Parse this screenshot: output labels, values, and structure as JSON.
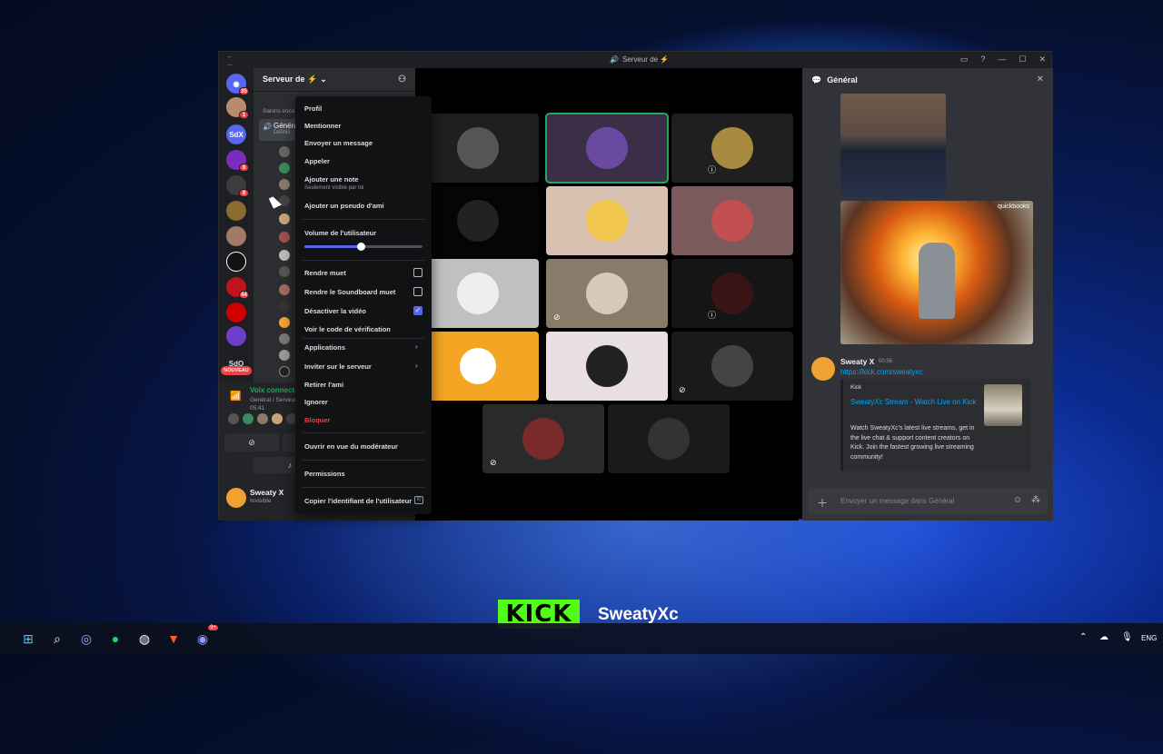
{
  "window": {
    "title": "Serveur de ⚡",
    "nav": "← →"
  },
  "servers": [
    {
      "name": "Discord",
      "badge": "35",
      "color": "#5865f2",
      "text": ""
    },
    {
      "name": "avatar-server",
      "badge": "1",
      "color": "#b88b6e",
      "text": ""
    },
    {
      "name": "SdX",
      "badge": "",
      "color": "#5865f2",
      "text": "SdX"
    },
    {
      "name": "purple-server",
      "badge": "8",
      "color": "#7b2cbf",
      "text": ""
    },
    {
      "name": "emblem-server",
      "badge": "8",
      "color": "#3c3c3c",
      "text": ""
    },
    {
      "name": "gold-server",
      "badge": "",
      "color": "#8a6d2e",
      "text": ""
    },
    {
      "name": "photo-server",
      "badge": "",
      "color": "#a07a66",
      "text": ""
    },
    {
      "name": "black-server",
      "badge": "",
      "color": "#111",
      "text": ""
    },
    {
      "name": "red-server",
      "badge": "44",
      "color": "#c1121f",
      "text": ""
    },
    {
      "name": "rg-server",
      "badge": "",
      "color": "#d00000",
      "text": ""
    },
    {
      "name": "violet-server",
      "badge": "",
      "color": "#6c3ec9",
      "text": ""
    }
  ],
  "new_server": {
    "text": "SdO",
    "badge": "NOUVEAU"
  },
  "channel_panel": {
    "server_name": "Serveur de ⚡",
    "section": "Salons voca",
    "active_channel": "Généra",
    "active_channel_sub": "Définis"
  },
  "voice": {
    "status": "Voix connectée",
    "location": "Général / Serveur",
    "time": "05:41"
  },
  "user": {
    "name": "Sweaty X",
    "status": "Invisible"
  },
  "context_menu": {
    "profile": "Profil",
    "mention": "Mentionner",
    "send_message": "Envoyer un message",
    "call": "Appeler",
    "add_note": "Ajouter une note",
    "add_note_sub": "Seulement visible par toi",
    "add_nickname": "Ajouter un pseudo d'ami",
    "user_volume": "Volume de l'utilisateur",
    "user_volume_value": 0.48,
    "mute": "Rendre muet",
    "mute_soundboard": "Rendre le Soundboard muet",
    "disable_video": "Désactiver la vidéo",
    "verification_code": "Voir le code de vérification",
    "applications": "Applications",
    "invite": "Inviter sur le serveur",
    "remove_friend": "Retirer l'ami",
    "ignore": "Ignorer",
    "block": "Bloquer",
    "moderator_view": "Ouvrir en vue du modérateur",
    "permissions": "Permissions",
    "copy_id": "Copier l'identifiant de l'utilisateur",
    "copy_id_badge": "ID"
  },
  "chat": {
    "channel": "Général",
    "image_watermark": "quickbooks",
    "message": {
      "author": "Sweaty X",
      "time": "00:56",
      "link": "https://kick.com/sweatyxc"
    },
    "embed": {
      "provider": "Kick",
      "title": "SweatyXc Stream - Watch Live on Kick",
      "description": "Watch SweatyXc's latest live streams, get in the live chat & support content creators on Kick. Join the fastest growing live streaming community!"
    },
    "composer_placeholder": "Envoyer un message dans Général"
  },
  "overlay": {
    "logo": "KICK",
    "channel": "SweatyXc"
  },
  "taskbar": {
    "language": "ENG",
    "discord_badge": "9+"
  }
}
